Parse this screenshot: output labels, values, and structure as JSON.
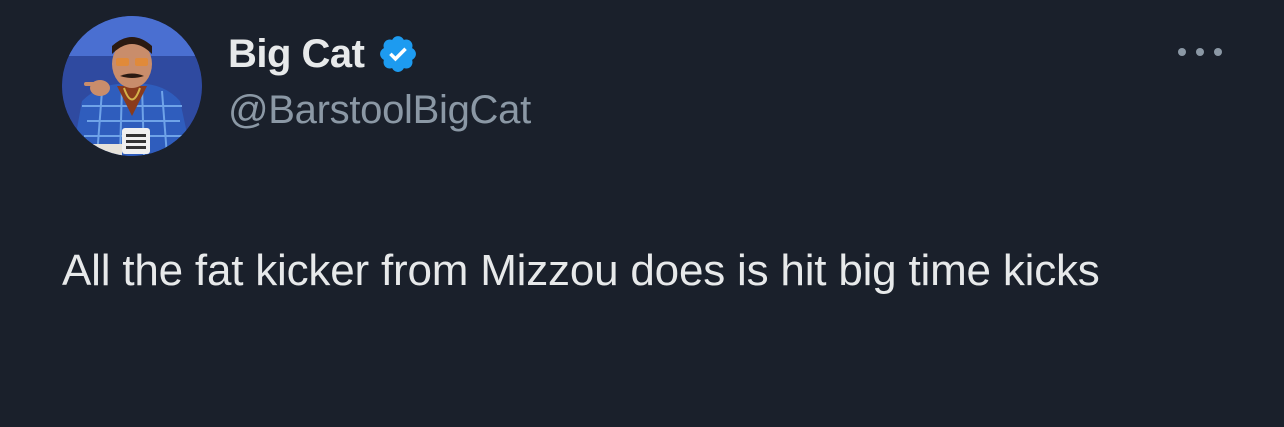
{
  "author": {
    "display_name": "Big Cat",
    "handle": "@BarstoolBigCat",
    "verified_icon": "verified-badge-icon",
    "verified_color": "#1d9bf0"
  },
  "tweet": {
    "text": "All the fat kicker from Mizzou does is hit big time kicks"
  },
  "menu": {
    "icon": "more-options-icon"
  },
  "colors": {
    "background": "#1a202b",
    "primary_text": "#e7e9ea",
    "secondary_text": "#8b98a5"
  }
}
